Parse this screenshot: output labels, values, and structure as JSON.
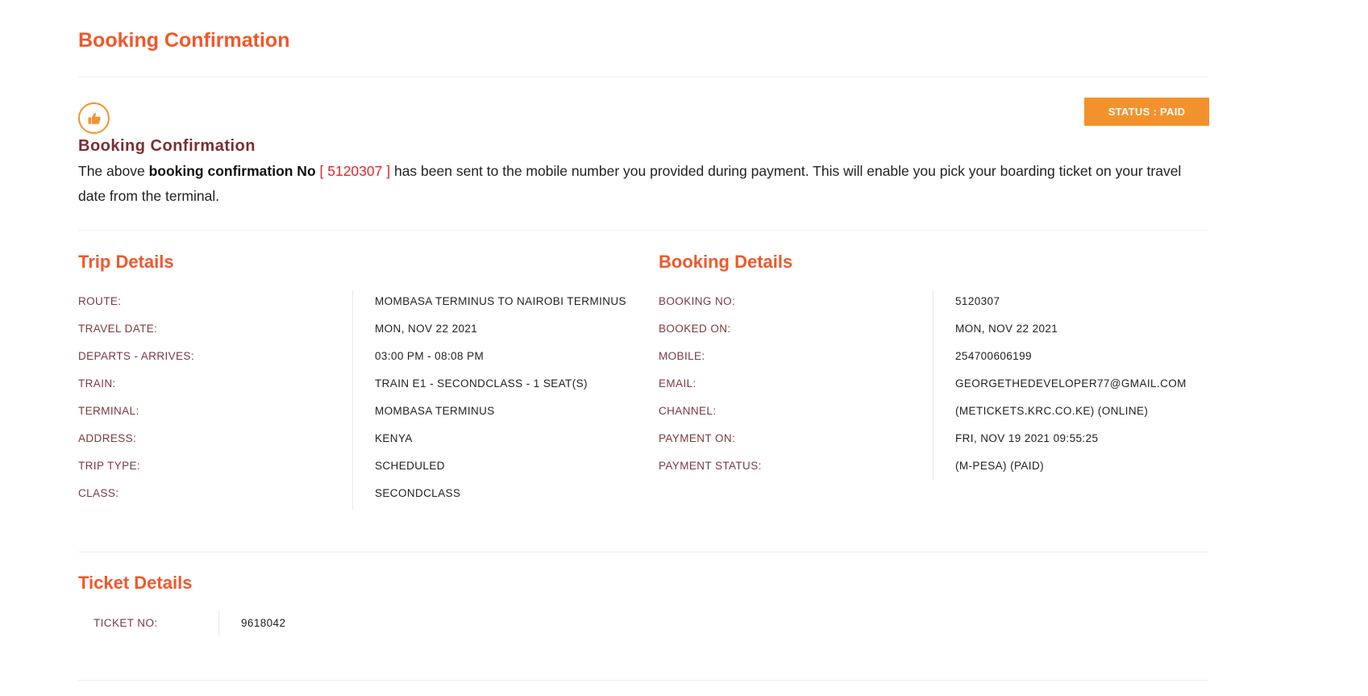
{
  "page_title": "Booking Confirmation",
  "status_badge": "STATUS : PAID",
  "confirmation": {
    "heading": "Booking Confirmation",
    "text_prefix": "The above ",
    "text_bold": "booking confirmation No",
    "bracket_open": " [ ",
    "number": "5120307",
    "bracket_close": " ]",
    "text_suffix": " has been sent to the mobile number you provided during payment. This will enable you pick your boarding ticket on your travel date from the terminal."
  },
  "trip_details": {
    "title": "Trip Details",
    "rows": [
      {
        "label": "ROUTE:",
        "value": "MOMBASA TERMINUS TO NAIROBI TERMINUS"
      },
      {
        "label": "TRAVEL DATE:",
        "value": "MON, NOV 22 2021"
      },
      {
        "label": "DEPARTS - ARRIVES:",
        "value": "03:00 PM - 08:08 PM"
      },
      {
        "label": "TRAIN:",
        "value": "TRAIN E1 - SECONDCLASS - 1 SEAT(S)"
      },
      {
        "label": "TERMINAL:",
        "value": "MOMBASA TERMINUS"
      },
      {
        "label": "ADDRESS:",
        "value": "KENYA"
      },
      {
        "label": "TRIP TYPE:",
        "value": "SCHEDULED"
      },
      {
        "label": "CLASS:",
        "value": "SECONDCLASS"
      }
    ]
  },
  "booking_details": {
    "title": "Booking Details",
    "rows": [
      {
        "label": "BOOKING NO:",
        "value": "5120307"
      },
      {
        "label": "BOOKED ON:",
        "value": "MON, NOV 22 2021"
      },
      {
        "label": "MOBILE:",
        "value": "254700606199"
      },
      {
        "label": "EMAIL:",
        "value": "GEORGETHEDEVELOPER77@GMAIL.COM"
      },
      {
        "label": "CHANNEL:",
        "value": "(METICKETS.KRC.CO.KE) (ONLINE)"
      },
      {
        "label": "PAYMENT ON:",
        "value": "FRI, NOV 19 2021 09:55:25"
      },
      {
        "label": "PAYMENT STATUS:",
        "value": "(M-PESA) (PAID)"
      }
    ]
  },
  "ticket_details": {
    "title": "Ticket Details",
    "rows": [
      {
        "label": "TICKET NO:",
        "value": "9618042"
      }
    ]
  },
  "colors": {
    "accent": "#f0582b",
    "badge": "#f3922c",
    "heading_maroon": "#7a2e33",
    "label": "#7a3a3e",
    "highlight_number": "#e3262c"
  },
  "icons": {
    "confirmation": "thumbs-up-icon"
  }
}
